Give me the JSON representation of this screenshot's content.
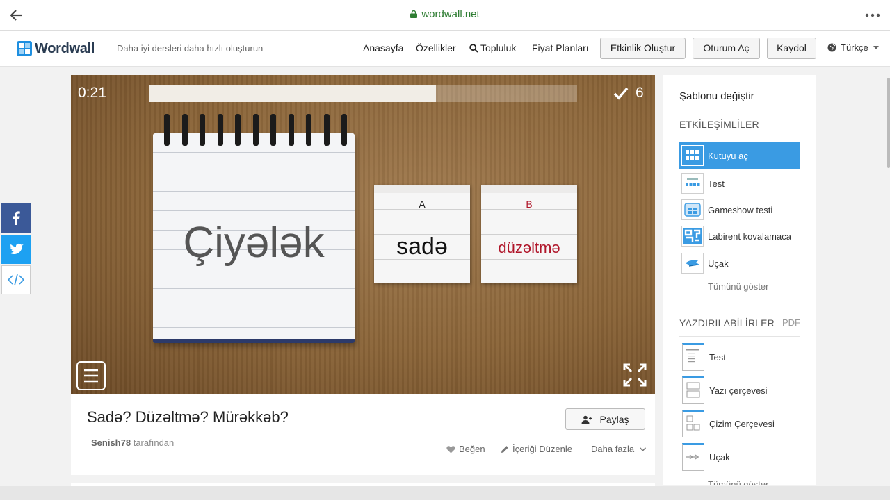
{
  "browser": {
    "url": "wordwall.net"
  },
  "header": {
    "logo": "Wordwall",
    "tagline": "Daha iyi dersleri daha hızlı oluşturun",
    "nav": [
      "Anasayfa",
      "Özellikler",
      "Topluluk",
      "Fiyat Planları"
    ],
    "create_button": "Etkinlik Oluştur",
    "login_button": "Oturum Aç",
    "register_button": "Kaydol",
    "language": "Türkçe"
  },
  "game": {
    "timer": "0:21",
    "progress": 0.67,
    "score": "6",
    "word": "Çiyələk",
    "card_a": {
      "letter": "A",
      "word": "sadə",
      "color": "#111111"
    },
    "card_b": {
      "letter": "B",
      "word": "düzəltmə",
      "color": "#b0162a"
    }
  },
  "activity": {
    "title": "Sadə? Düzəltmə? Mürəkkəb?",
    "author": "Senish78",
    "author_suffix": "tarafından",
    "share_button": "Paylaş",
    "like": "Beğen",
    "edit": "İçeriği Düzenle",
    "more": "Daha fazla"
  },
  "sidebar": {
    "title": "Şablonu değiştir",
    "interactive_heading": "ETKİLEŞİMLİLER",
    "interactive": [
      "Kutuyu aç",
      "Test",
      "Gameshow testi",
      "Labirent kovalamaca",
      "Uçak"
    ],
    "show_all": "Tümünü göster",
    "printable_heading": "YAZDIRILABİLİRLER",
    "pdf": "PDF",
    "printables": [
      "Test",
      "Yazı çerçevesi",
      "Çizim Çerçevesi",
      "Uçak"
    ],
    "show_all_2": "Tümünü göster"
  },
  "colors": {
    "accent": "#3a9be3",
    "facebook": "#3b5998",
    "twitter": "#1da1f2",
    "url_green": "#2e7d32"
  }
}
